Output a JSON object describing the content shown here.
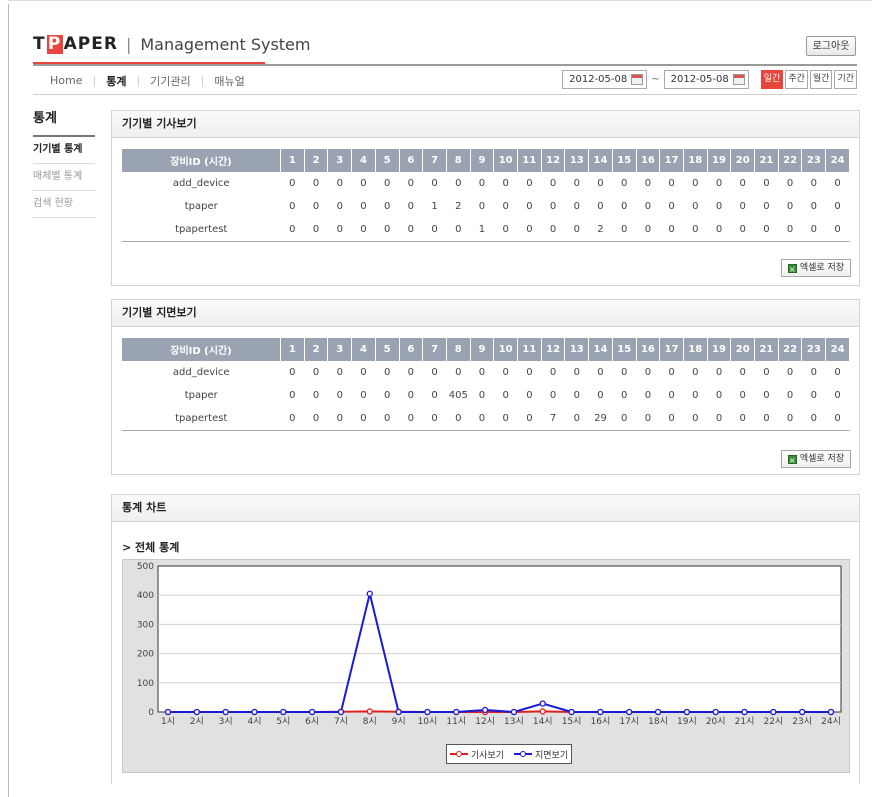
{
  "header": {
    "logo_t": "T",
    "logo_p": "P",
    "logo_rest": "APER",
    "logo_sep": "|",
    "system_name": "Management System",
    "logout_label": "로그아웃"
  },
  "nav": {
    "items": [
      "Home",
      "통계",
      "기기관리",
      "매뉴얼"
    ],
    "active_index": 1
  },
  "date_range": {
    "start": "2012-05-08",
    "end": "2012-05-08",
    "separator": "~",
    "periods": [
      "일간",
      "주간",
      "월간",
      "기간"
    ],
    "active_period": 0
  },
  "sidebar": {
    "title": "통계",
    "items": [
      "기기별 통계",
      "매체별 통계",
      "검색 현황"
    ],
    "active_index": 0
  },
  "panel1": {
    "title": "기기별 기사보기",
    "first_col": "장비ID (시간)",
    "hours": [
      "1",
      "2",
      "3",
      "4",
      "5",
      "6",
      "7",
      "8",
      "9",
      "10",
      "11",
      "12",
      "13",
      "14",
      "15",
      "16",
      "17",
      "18",
      "19",
      "20",
      "21",
      "22",
      "23",
      "24"
    ],
    "rows": [
      {
        "id": "add_device",
        "values": [
          0,
          0,
          0,
          0,
          0,
          0,
          0,
          0,
          0,
          0,
          0,
          0,
          0,
          0,
          0,
          0,
          0,
          0,
          0,
          0,
          0,
          0,
          0,
          0
        ]
      },
      {
        "id": "tpaper",
        "values": [
          0,
          0,
          0,
          0,
          0,
          0,
          1,
          2,
          0,
          0,
          0,
          0,
          0,
          0,
          0,
          0,
          0,
          0,
          0,
          0,
          0,
          0,
          0,
          0
        ]
      },
      {
        "id": "tpapertest",
        "values": [
          0,
          0,
          0,
          0,
          0,
          0,
          0,
          0,
          1,
          0,
          0,
          0,
          0,
          2,
          0,
          0,
          0,
          0,
          0,
          0,
          0,
          0,
          0,
          0
        ]
      }
    ],
    "excel_label": "엑셀로 저장"
  },
  "panel2": {
    "title": "기기별 지면보기",
    "first_col": "장비ID (시간)",
    "hours": [
      "1",
      "2",
      "3",
      "4",
      "5",
      "6",
      "7",
      "8",
      "9",
      "10",
      "11",
      "12",
      "13",
      "14",
      "15",
      "16",
      "17",
      "18",
      "19",
      "20",
      "21",
      "22",
      "23",
      "24"
    ],
    "rows": [
      {
        "id": "add_device",
        "values": [
          0,
          0,
          0,
          0,
          0,
          0,
          0,
          0,
          0,
          0,
          0,
          0,
          0,
          0,
          0,
          0,
          0,
          0,
          0,
          0,
          0,
          0,
          0,
          0
        ]
      },
      {
        "id": "tpaper",
        "values": [
          0,
          0,
          0,
          0,
          0,
          0,
          0,
          405,
          0,
          0,
          0,
          0,
          0,
          0,
          0,
          0,
          0,
          0,
          0,
          0,
          0,
          0,
          0,
          0
        ]
      },
      {
        "id": "tpapertest",
        "values": [
          0,
          0,
          0,
          0,
          0,
          0,
          0,
          0,
          0,
          0,
          0,
          7,
          0,
          29,
          0,
          0,
          0,
          0,
          0,
          0,
          0,
          0,
          0,
          0
        ]
      }
    ],
    "excel_label": "엑셀로 저장"
  },
  "chart_panel": {
    "title": "통계 차트",
    "subtitle": "> 전체 통계"
  },
  "chart_data": {
    "type": "line",
    "x": [
      "1시",
      "2시",
      "3시",
      "4시",
      "5시",
      "6시",
      "7시",
      "8시",
      "9시",
      "10시",
      "11시",
      "12시",
      "13시",
      "14시",
      "15시",
      "16시",
      "17시",
      "18시",
      "19시",
      "20시",
      "21시",
      "22시",
      "23시",
      "24시"
    ],
    "yticks": [
      0,
      100,
      200,
      300,
      400,
      500
    ],
    "ylim": [
      0,
      500
    ],
    "grid": true,
    "legend_position": "bottom",
    "series": [
      {
        "name": "기사보기",
        "color": "#e02020",
        "values": [
          0,
          0,
          0,
          0,
          0,
          0,
          1,
          2,
          1,
          0,
          0,
          0,
          0,
          2,
          0,
          0,
          0,
          0,
          0,
          0,
          0,
          0,
          0,
          0
        ]
      },
      {
        "name": "지면보기",
        "color": "#1a1ad6",
        "values": [
          0,
          0,
          0,
          0,
          0,
          0,
          0,
          405,
          0,
          0,
          0,
          7,
          0,
          29,
          0,
          0,
          0,
          0,
          0,
          0,
          0,
          0,
          0,
          0
        ]
      }
    ]
  }
}
